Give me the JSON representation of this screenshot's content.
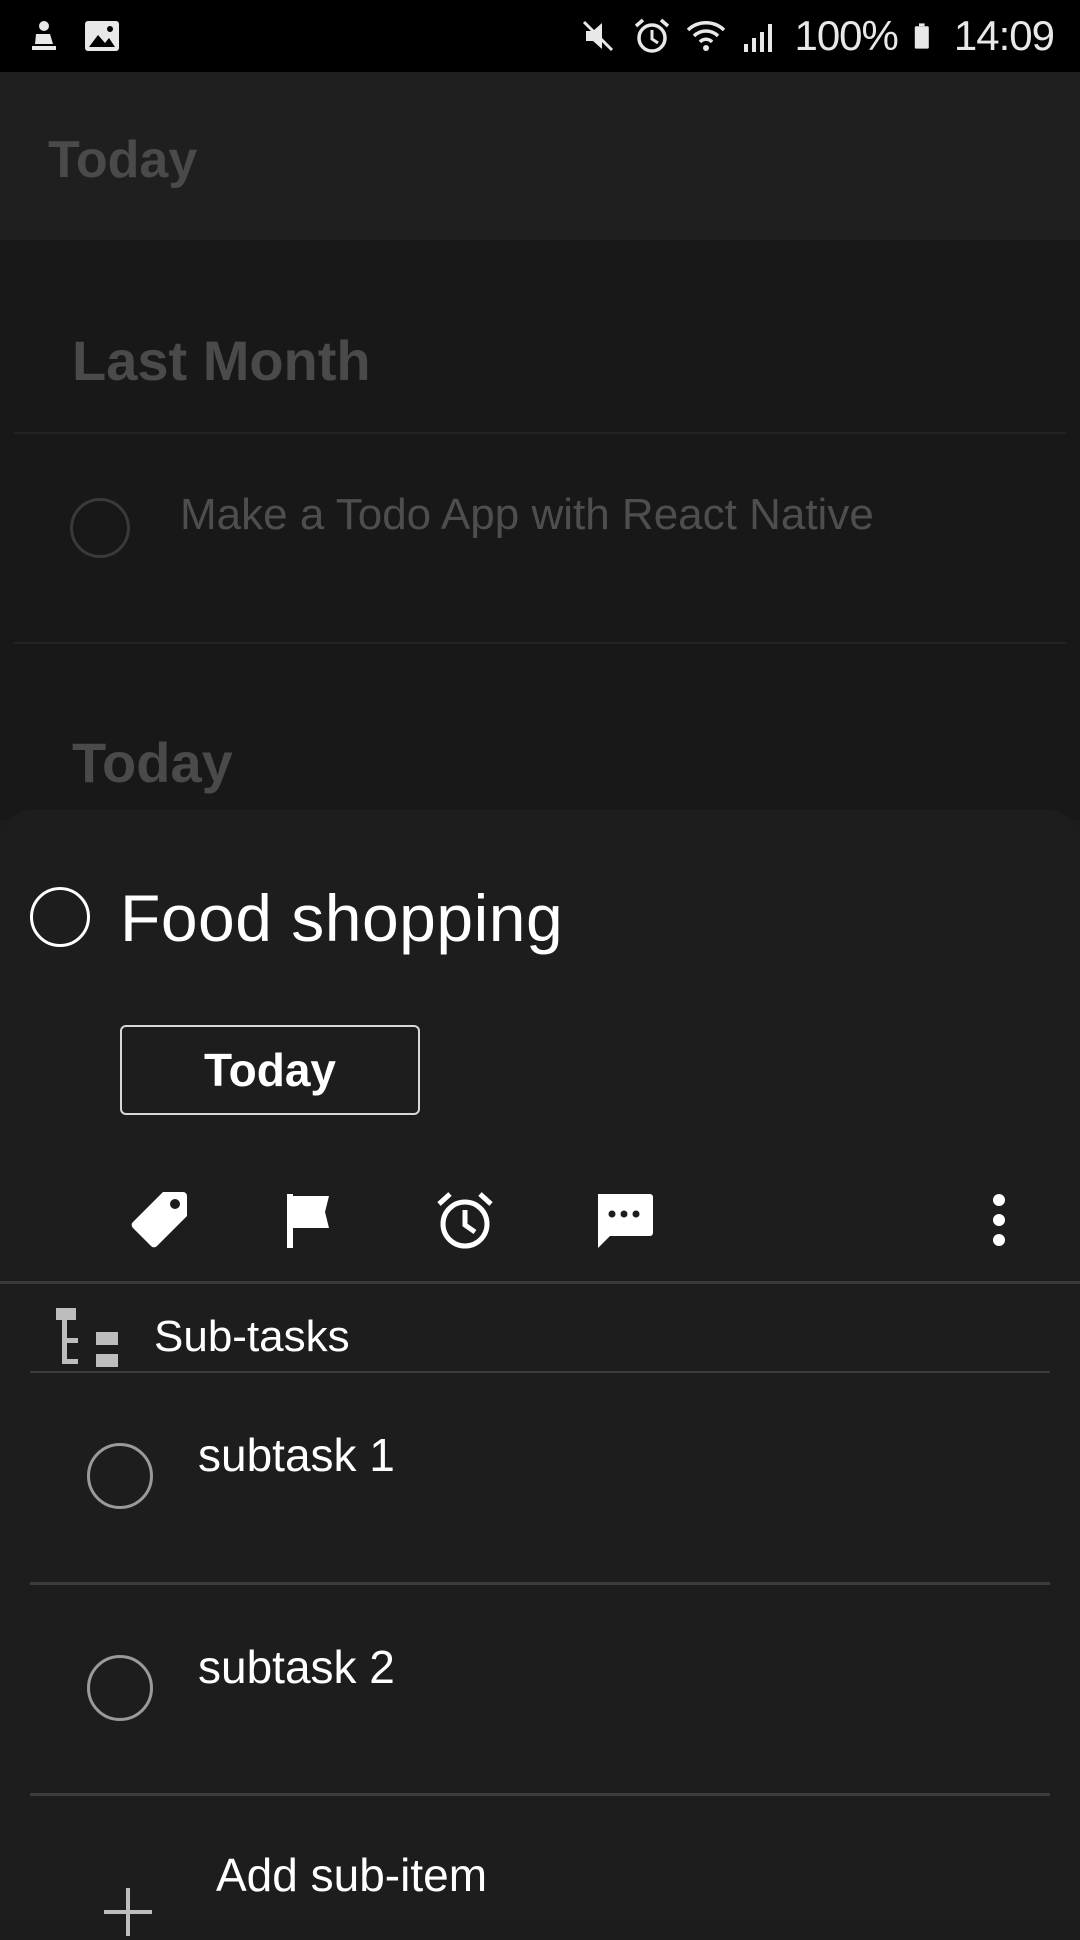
{
  "status_bar": {
    "left_icons": [
      "notification-icon",
      "image-icon"
    ],
    "right_icons": [
      "mute-icon",
      "alarm-icon",
      "wifi-icon",
      "signal-icon",
      "battery-icon"
    ],
    "battery": "100%",
    "time": "14:09"
  },
  "background": {
    "header_title": "Today",
    "sections": [
      {
        "title": "Last Month",
        "tasks": [
          {
            "text": "Make a Todo App with React Native"
          }
        ]
      },
      {
        "title": "Today"
      }
    ]
  },
  "sheet": {
    "task_title": "Food shopping",
    "due_button": "Today",
    "toolbar_icons": [
      "tag-icon",
      "flag-icon",
      "alarm-icon",
      "comment-icon",
      "more-vert-icon"
    ],
    "subtasks_label": "Sub-tasks",
    "subtasks": [
      {
        "text": "subtask 1"
      },
      {
        "text": "subtask 2"
      }
    ],
    "add_label": "Add sub-item"
  }
}
